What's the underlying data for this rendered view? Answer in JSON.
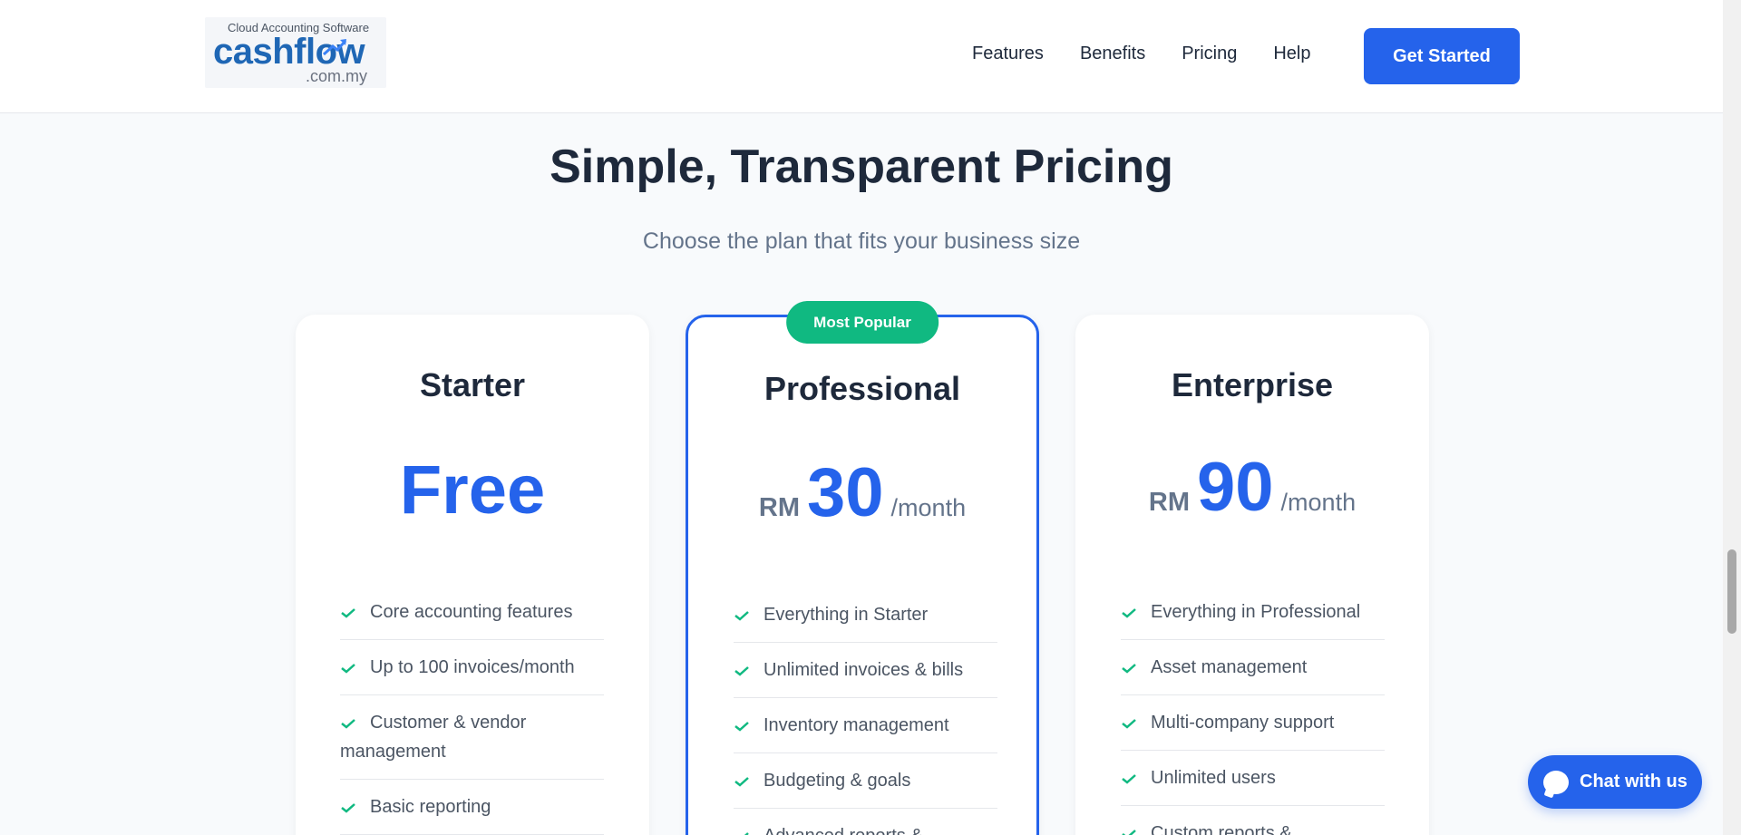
{
  "logo": {
    "tagline": "Cloud Accounting Software",
    "word": "cashflow",
    "domain": ".com.my"
  },
  "nav": {
    "items": [
      "Features",
      "Benefits",
      "Pricing",
      "Help"
    ],
    "cta": "Get Started"
  },
  "section": {
    "title": "Simple, Transparent Pricing",
    "subtitle": "Choose the plan that fits your business size"
  },
  "plans": [
    {
      "name": "Starter",
      "price": "Free",
      "features": [
        "Core accounting features",
        "Up to 100 invoices/month",
        "Customer & vendor management",
        "Basic reporting"
      ]
    },
    {
      "name": "Professional",
      "badge": "Most Popular",
      "currency": "RM",
      "amount": "30",
      "period": "/month",
      "features": [
        "Everything in Starter",
        "Unlimited invoices & bills",
        "Inventory management",
        "Budgeting & goals",
        "Advanced reports &"
      ]
    },
    {
      "name": "Enterprise",
      "currency": "RM",
      "amount": "90",
      "period": "/month",
      "features": [
        "Everything in Professional",
        "Asset management",
        "Multi-company support",
        "Unlimited users",
        "Custom reports &"
      ]
    }
  ],
  "chat": {
    "label": "Chat with us"
  },
  "colors": {
    "accent": "#2563eb",
    "badge": "#10b981",
    "check": "#10b981"
  }
}
